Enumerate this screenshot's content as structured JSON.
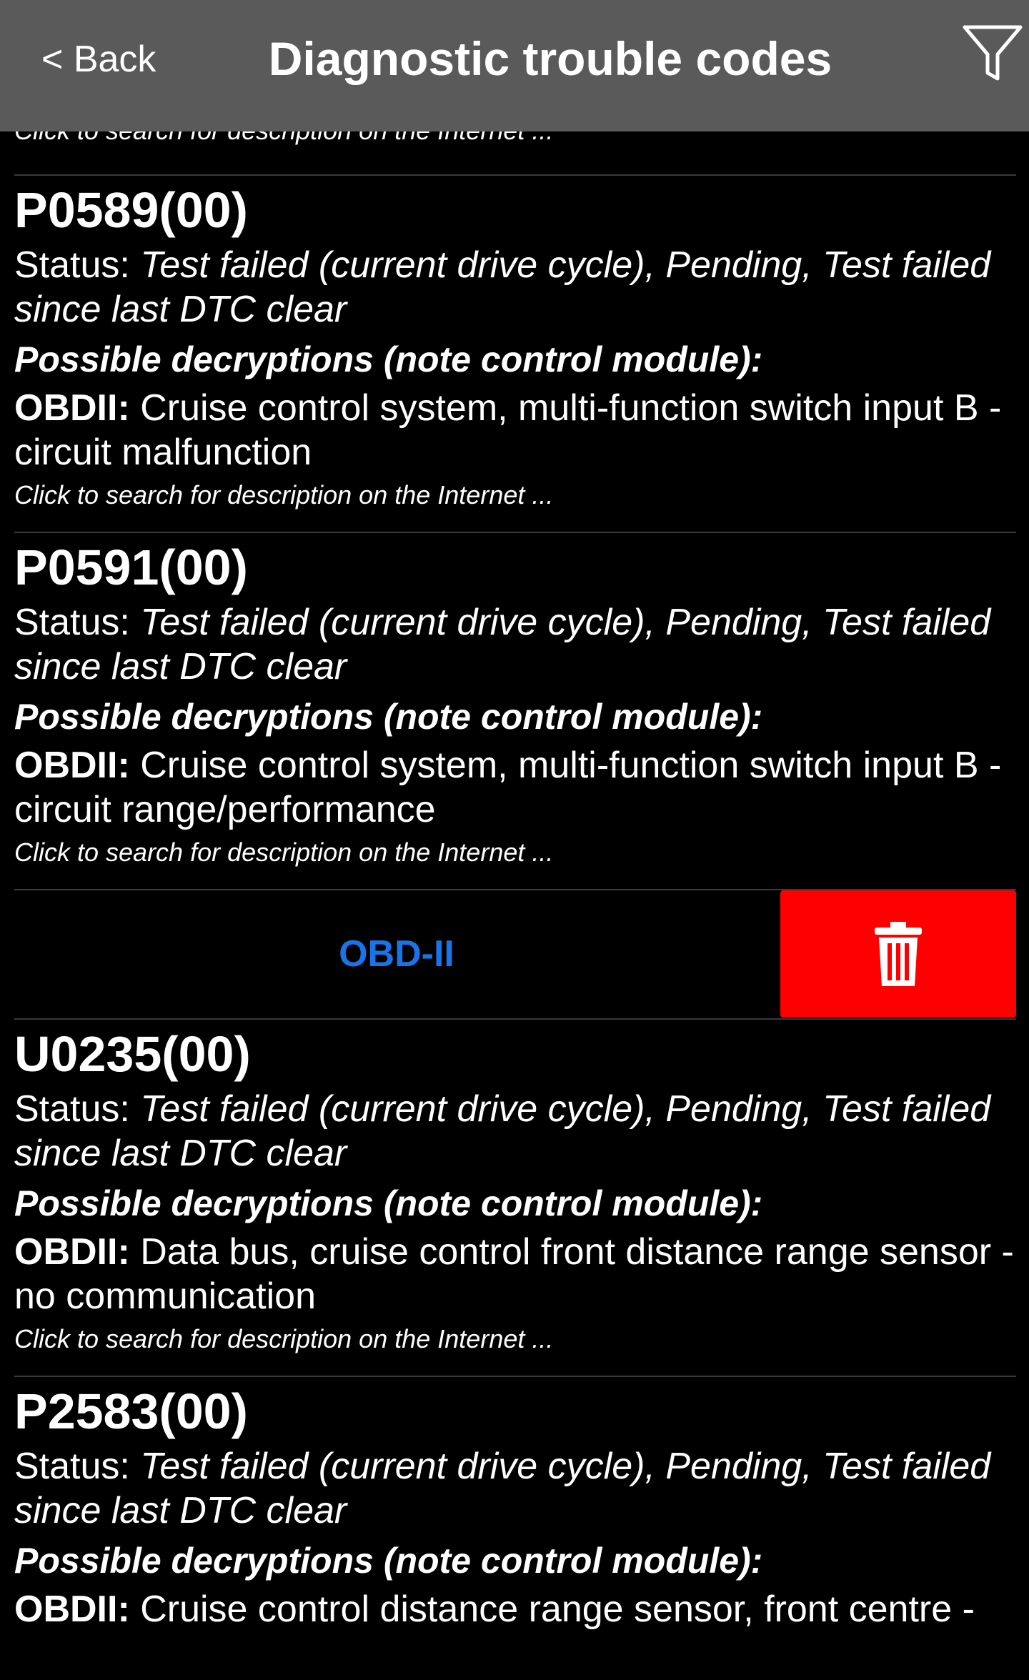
{
  "header": {
    "back_label": "< Back",
    "title": "Diagnostic trouble codes",
    "filter_icon": "filter-funnel-icon"
  },
  "list": {
    "clipped_top_text": "Click to search for description on the Internet ...",
    "module_group": {
      "label": "OBD-II",
      "label_color": "#1a73e8",
      "delete_color": "#ff0000",
      "delete_icon": "trash-icon"
    },
    "entries": [
      {
        "code": "P0589(00)",
        "status_label": "Status:",
        "status_value": "Test failed (current drive cycle), Pending, Test failed since last DTC clear",
        "possible_label": "Possible decryptions (note control module):",
        "desc_label": "OBDII:",
        "desc_value": "Cruise control system, multi-function switch input B - circuit malfunction",
        "click_text": "Click to search for description on the Internet ..."
      },
      {
        "code": "P0591(00)",
        "status_label": "Status:",
        "status_value": "Test failed (current drive cycle), Pending, Test failed since last DTC clear",
        "possible_label": "Possible decryptions (note control module):",
        "desc_label": "OBDII:",
        "desc_value": "Cruise control system, multi-function switch input B - circuit range/performance",
        "click_text": "Click to search for description on the Internet ..."
      },
      {
        "code": "U0235(00)",
        "status_label": "Status:",
        "status_value": "Test failed (current drive cycle), Pending, Test failed since last DTC clear",
        "possible_label": "Possible decryptions (note control module):",
        "desc_label": "OBDII:",
        "desc_value": "Data bus, cruise control front distance range sensor - no communication",
        "click_text": "Click to search for description on the Internet ..."
      },
      {
        "code": "P2583(00)",
        "status_label": "Status:",
        "status_value": "Test failed (current drive cycle), Pending, Test failed since last DTC clear",
        "possible_label": "Possible decryptions (note control module):",
        "desc_label": "OBDII:",
        "desc_value": "Cruise control distance range sensor, front centre -"
      }
    ]
  }
}
